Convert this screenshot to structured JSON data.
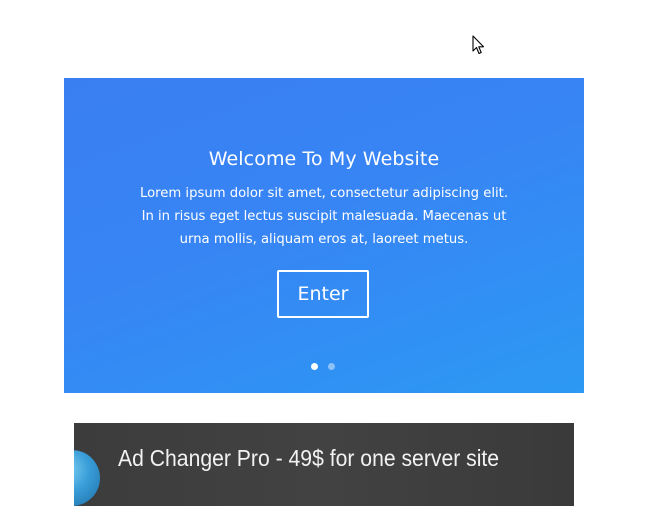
{
  "hero": {
    "title": "Welcome To My Website",
    "text": "Lorem ipsum dolor sit amet, consectetur adipiscing elit. In in risus eget lectus suscipit malesuada. Maecenas ut urna mollis, aliquam eros at, laoreet metus.",
    "button_label": "Enter",
    "slides_total": 2,
    "active_slide": 1,
    "colors": {
      "gradient_start": "#3a7ff2",
      "gradient_end": "#2c99f3"
    }
  },
  "ad_banner": {
    "text": "Ad Changer Pro - 49$ for one server site",
    "icon": "globe-icon",
    "background": "#3c3c3c"
  },
  "cursor": {
    "icon": "mouse-pointer-icon"
  }
}
